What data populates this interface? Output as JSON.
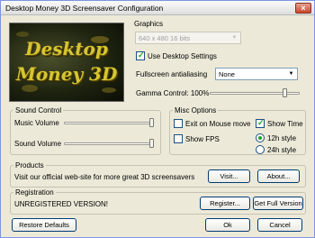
{
  "window": {
    "title": "Desktop Money 3D Screensaver Configuration"
  },
  "preview": {
    "line1": "Desktop",
    "line2": "Money 3D"
  },
  "graphics": {
    "title": "Graphics",
    "resolution_value": "640 x 480 16 bits",
    "use_desktop_settings_label": "Use Desktop Settings",
    "use_desktop_settings_checked": true,
    "fsaa_label": "Fullscreen antialiasing",
    "fsaa_value": "None",
    "gamma_label": "Gamma Control: 100%",
    "gamma_level": 0.85
  },
  "sound": {
    "title": "Sound Control",
    "music_label": "Music Volume",
    "music_level": 1.0,
    "sound_label": "Sound Volume",
    "sound_level": 1.0
  },
  "misc": {
    "title": "Misc Options",
    "exit_on_mouse_label": "Exit on Mouse move",
    "exit_on_mouse_checked": false,
    "show_time_label": "Show Time",
    "show_time_checked": true,
    "show_fps_label": "Show FPS",
    "show_fps_checked": false,
    "style_12h_label": "12h style",
    "style_12h_selected": true,
    "style_24h_label": "24h style",
    "style_24h_selected": false
  },
  "products": {
    "title": "Products",
    "text": "Visit our official web-site for more great 3D screensavers",
    "visit_label": "Visit...",
    "about_label": "About..."
  },
  "registration": {
    "title": "Registration",
    "status": "UNREGISTERED VERSION!",
    "register_label": "Register...",
    "full_version_label": "Get Full Version"
  },
  "footer": {
    "restore_label": "Restore Defaults",
    "ok_label": "Ok",
    "cancel_label": "Cancel"
  }
}
